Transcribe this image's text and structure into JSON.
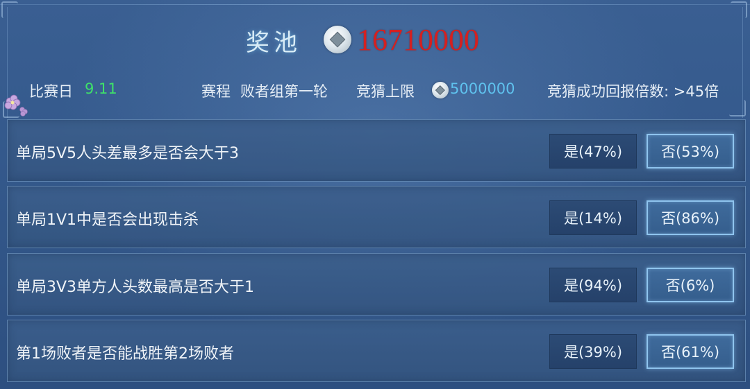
{
  "header": {
    "pool_title": "奖池",
    "pool_amount": "16710000",
    "coin_icon": "coin-icon",
    "pool_amount_color": "#d42020"
  },
  "info": {
    "match_day_label": "比赛日",
    "match_day_value": "9.11",
    "schedule_label": "赛程",
    "schedule_value": "败者组第一轮",
    "limit_label": "竞猜上限",
    "limit_value": "5000000",
    "payout_label": "竞猜成功回报倍数: >45倍",
    "match_day_color": "#3fe06a",
    "limit_color": "#5fc2ee"
  },
  "questions": [
    {
      "text": "单局5V5人头差最多是否会大于3",
      "yes": "是(47%)",
      "no": "否(53%)"
    },
    {
      "text": "单局1V1中是否会出现击杀",
      "yes": "是(14%)",
      "no": "否(86%)"
    },
    {
      "text": "单局3V3单方人头数最高是否大于1",
      "yes": "是(94%)",
      "no": "否(6%)"
    },
    {
      "text": "第1场败者是否能战胜第2场败者",
      "yes": "是(39%)",
      "no": "否(61%)"
    }
  ]
}
